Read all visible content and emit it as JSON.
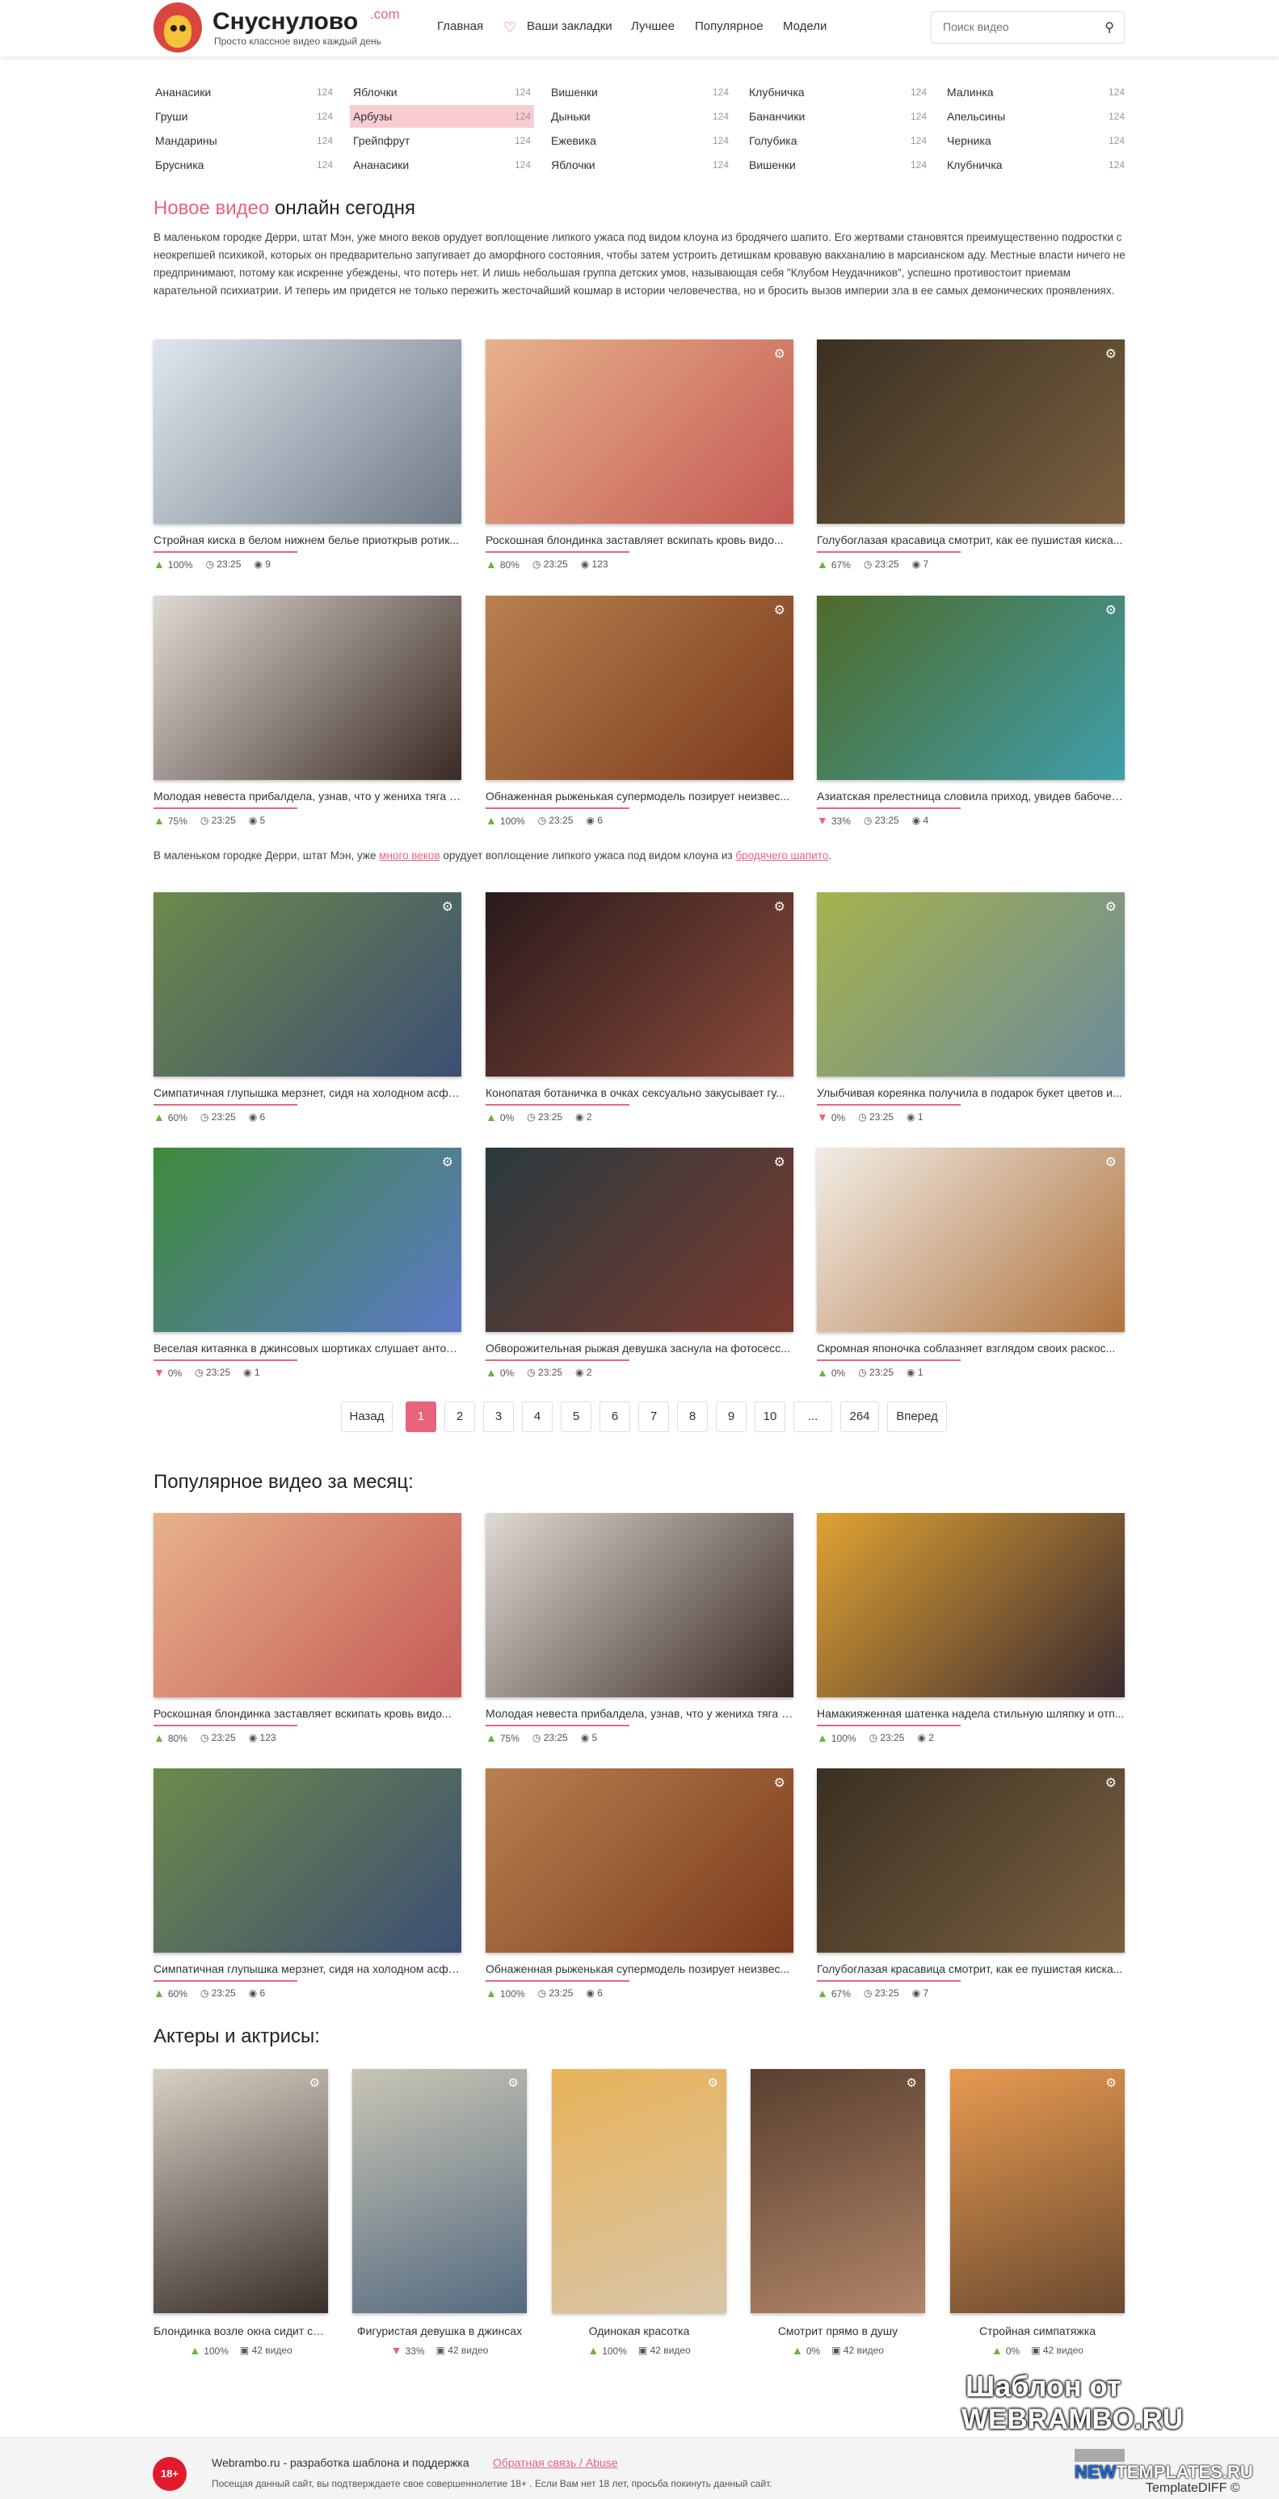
{
  "header": {
    "logo_title": "Снуснулово",
    "logo_com": ".com",
    "logo_sub": "Просто классное видео каждый день",
    "nav": [
      "Главная",
      "Ваши закладки",
      "Лучшее",
      "Популярное",
      "Модели"
    ],
    "search_placeholder": "Поиск видео"
  },
  "categories": [
    {
      "name": "Ананасики",
      "count": "124"
    },
    {
      "name": "Яблочки",
      "count": "124"
    },
    {
      "name": "Вишенки",
      "count": "124"
    },
    {
      "name": "Клубничка",
      "count": "124"
    },
    {
      "name": "Малинка",
      "count": "124"
    },
    {
      "name": "Груши",
      "count": "124"
    },
    {
      "name": "Арбузы",
      "count": "124",
      "active": true
    },
    {
      "name": "Дыньки",
      "count": "124"
    },
    {
      "name": "Бананчики",
      "count": "124"
    },
    {
      "name": "Апельсины",
      "count": "124"
    },
    {
      "name": "Мандарины",
      "count": "124"
    },
    {
      "name": "Грейпфрут",
      "count": "124"
    },
    {
      "name": "Ежевика",
      "count": "124"
    },
    {
      "name": "Голубика",
      "count": "124"
    },
    {
      "name": "Черника",
      "count": "124"
    },
    {
      "name": "Брусника",
      "count": "124"
    },
    {
      "name": "Ананасики",
      "count": "124"
    },
    {
      "name": "Яблочки",
      "count": "124"
    },
    {
      "name": "Вишенки",
      "count": "124"
    },
    {
      "name": "Клубничка",
      "count": "124"
    }
  ],
  "new_video": {
    "title_accent": "Новое видео",
    "title_rest": " онлайн сегодня",
    "description": "В маленьком городке Дерри, штат Мэн, уже много веков орудует воплощение липкого ужаса под видом клоуна из бродячего шапито. Его жертвами становятся преимущественно подростки с неокрепшей психикой, которых он предварительно запугивает до аморфного состояния, чтобы затем устроить детишкам кровавую вакханалию в марсианском аду. Местные власти ничего не предпринимают, потому как искренне убеждены, что потерь нет. И лишь небольшая группа детских умов, называющая себя \"Клубом Неудачников\", успешно противостоит приемам карательной психиатрии. И теперь им придется не только пережить жесточайший кошмар в истории человечества, но и бросить вызов империи зла в ее самых демонических проявлениях.",
    "inline_text_1": "В маленьком городке Дерри, штат Мэн, уже ",
    "inline_link_1": "много веков",
    "inline_text_2": " орудует воплощение липкого ужаса под видом клоуна из ",
    "inline_link_2": "бродячего шапито",
    "inline_text_3": "."
  },
  "videos": [
    {
      "title": "Стройная киска в белом нижнем белье приоткрыв ротик...",
      "rating": "100%",
      "vote": "up",
      "duration": "23:25",
      "views": "9",
      "gear": false,
      "colors": [
        "#dfe6ee",
        "#6f7a86"
      ]
    },
    {
      "title": "Роскошная блондинка заставляет вскипать кровь видо...",
      "rating": "80%",
      "vote": "up",
      "duration": "23:25",
      "views": "123",
      "gear": true,
      "colors": [
        "#e7b28a",
        "#c55a55"
      ]
    },
    {
      "title": "Голубоглазая красавица смотрит, как ее пушистая киска...",
      "rating": "67%",
      "vote": "up",
      "duration": "23:25",
      "views": "7",
      "gear": true,
      "colors": [
        "#3a3022",
        "#7a6040"
      ]
    },
    {
      "title": "Молодая невеста прибалдела, узнав, что у жениха тяга к...",
      "rating": "75%",
      "vote": "up",
      "duration": "23:25",
      "views": "5",
      "gear": false,
      "colors": [
        "#e0dad4",
        "#3a2a25"
      ]
    },
    {
      "title": "Обнаженная рыженькая супермодель позирует неизвес...",
      "rating": "100%",
      "vote": "up",
      "duration": "23:25",
      "views": "6",
      "gear": true,
      "colors": [
        "#b8814f",
        "#7a3a1c"
      ]
    },
    {
      "title": "Азиатская прелестница словила приход, увидев бабочек...",
      "rating": "33%",
      "vote": "down",
      "duration": "23:25",
      "views": "4",
      "gear": true,
      "colors": [
        "#4f6b2a",
        "#3f9ea9"
      ]
    },
    {
      "title": "Симпатичная глупышка мерзнет, сидя на холодном асфа...",
      "rating": "60%",
      "vote": "up",
      "duration": "23:25",
      "views": "6",
      "gear": true,
      "colors": [
        "#6c8a4b",
        "#3d4f73"
      ]
    },
    {
      "title": "Конопатая ботаничка в очках сексуально закусывает гу...",
      "rating": "0%",
      "vote": "up",
      "duration": "23:25",
      "views": "2",
      "gear": true,
      "colors": [
        "#2a1a1c",
        "#8a4a3a"
      ]
    },
    {
      "title": "Улыбчивая кореянка получила в подарок букет цветов и...",
      "rating": "0%",
      "vote": "down",
      "duration": "23:25",
      "views": "1",
      "gear": true,
      "colors": [
        "#a5b34e",
        "#6c8a9b"
      ]
    },
    {
      "title": "Веселая китаянка в джинсовых шортиках слушает антол...",
      "rating": "0%",
      "vote": "down",
      "duration": "23:25",
      "views": "1",
      "gear": true,
      "colors": [
        "#3f8a3a",
        "#5b79c7"
      ]
    },
    {
      "title": "Обворожительная рыжая девушка заснула на фотосесс...",
      "rating": "0%",
      "vote": "up",
      "duration": "23:25",
      "views": "2",
      "gear": true,
      "colors": [
        "#2a3a3e",
        "#7a3a30"
      ]
    },
    {
      "title": "Скромная японочка соблазняет взглядом своих раскос...",
      "rating": "0%",
      "vote": "up",
      "duration": "23:25",
      "views": "1",
      "gear": true,
      "colors": [
        "#f1ece6",
        "#b0743e"
      ]
    }
  ],
  "pagination": {
    "prev": "Назад",
    "pages": [
      "1",
      "2",
      "3",
      "4",
      "5",
      "6",
      "7",
      "8",
      "9",
      "10",
      "...",
      "264"
    ],
    "next": "Вперед"
  },
  "popular": {
    "title": "Популярное видео за месяц:",
    "videos": [
      {
        "title": "Роскошная блондинка заставляет вскипать кровь видо...",
        "rating": "80%",
        "vote": "up",
        "duration": "23:25",
        "views": "123",
        "gear": false,
        "colors": [
          "#e7b28a",
          "#c55a55"
        ]
      },
      {
        "title": "Молодая невеста прибалдела, узнав, что у жениха тяга к...",
        "rating": "75%",
        "vote": "up",
        "duration": "23:25",
        "views": "5",
        "gear": false,
        "colors": [
          "#e0dad4",
          "#3a2a25"
        ]
      },
      {
        "title": "Намакияженная шатенка надела стильную шляпку и отп...",
        "rating": "100%",
        "vote": "up",
        "duration": "23:25",
        "views": "2",
        "gear": false,
        "colors": [
          "#e0a232",
          "#3a2a30"
        ]
      },
      {
        "title": "Симпатичная глупышка мерзнет, сидя на холодном асфа...",
        "rating": "60%",
        "vote": "up",
        "duration": "23:25",
        "views": "6",
        "gear": false,
        "colors": [
          "#6c8a4b",
          "#3d4f73"
        ]
      },
      {
        "title": "Обнаженная рыженькая супермодель позирует неизвес...",
        "rating": "100%",
        "vote": "up",
        "duration": "23:25",
        "views": "6",
        "gear": true,
        "colors": [
          "#b8814f",
          "#7a3a1c"
        ]
      },
      {
        "title": "Голубоглазая красавица смотрит, как ее пушистая киска...",
        "rating": "67%",
        "vote": "up",
        "duration": "23:25",
        "views": "7",
        "gear": true,
        "colors": [
          "#3a3022",
          "#7a6040"
        ]
      }
    ]
  },
  "actors": {
    "title": "Актеры и актрисы:",
    "items": [
      {
        "name": "Блондинка возле окна сидит сп...",
        "rating": "100%",
        "vote": "up",
        "videos": "42 видео",
        "gear": true,
        "colors": [
          "#d8d0c5",
          "#3a2e28"
        ]
      },
      {
        "name": "Фигуристая девушка в джинсах",
        "rating": "33%",
        "vote": "down",
        "videos": "42 видео",
        "gear": true,
        "colors": [
          "#c8c5b5",
          "#556a80"
        ]
      },
      {
        "name": "Одинокая красотка",
        "rating": "100%",
        "vote": "up",
        "videos": "42 видео",
        "gear": true,
        "colors": [
          "#e8b35a",
          "#d8c5a8"
        ]
      },
      {
        "name": "Смотрит прямо в душу",
        "rating": "0%",
        "vote": "up",
        "videos": "42 видео",
        "gear": true,
        "colors": [
          "#5a4030",
          "#b08568"
        ]
      },
      {
        "name": "Стройная симпатяжка",
        "rating": "0%",
        "vote": "up",
        "videos": "42 видео",
        "gear": true,
        "colors": [
          "#e89a50",
          "#6a4a30"
        ]
      }
    ]
  },
  "footer": {
    "badge": "18+",
    "text": "Webrambo.ru - разработка шаблона и поддержка",
    "link": "Обратная связь / Abuse",
    "warning": "Посещая данный сайт, вы подтверждаете свое совершеннолетие 18+ . Если Вам нет 18 лет, просьба покинуть данный сайт."
  },
  "watermark": {
    "line1": "Шаблон от",
    "line2": "WEBRAMBO.RU",
    "new_a": "NEW",
    "new_b": "TEMPLATES.RU",
    "line4": "TemplateDIFF ©"
  }
}
